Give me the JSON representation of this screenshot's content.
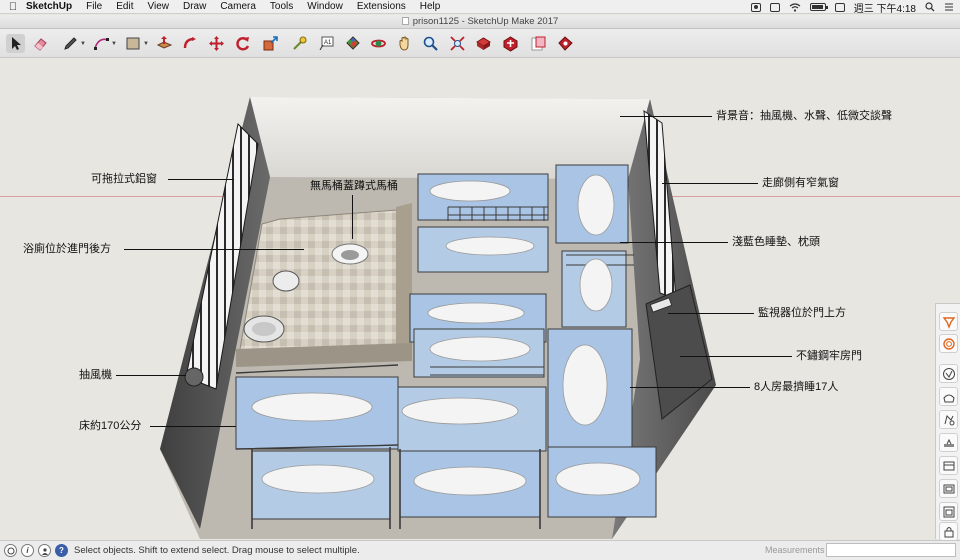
{
  "menubar": {
    "app_name": "SketchUp",
    "menus": [
      "File",
      "Edit",
      "View",
      "Draw",
      "Camera",
      "Tools",
      "Window",
      "Extensions",
      "Help"
    ],
    "clock": "週三 下午4:18"
  },
  "window": {
    "title": "prison1125 - SketchUp Make 2017"
  },
  "toolbar": {
    "tools": [
      "select-icon",
      "eraser-icon",
      "pencil-icon",
      "arc-icon",
      "rectangle-icon",
      "push-pull-icon",
      "follow-me-icon",
      "move-icon",
      "rotate-icon",
      "scale-icon",
      "tape-measure-icon",
      "text-icon",
      "paint-bucket-icon",
      "orbit-icon",
      "pan-icon",
      "zoom-icon",
      "zoom-extents-icon",
      "3d-warehouse-icon",
      "extension-warehouse-icon",
      "layout-icon",
      "extension-manager-icon"
    ]
  },
  "annotations": {
    "background_sound": "背景音：抽風機、水聲、低微交談聲",
    "corridor_window": "走廊側有窄氣窗",
    "sliding_window": "可拖拉式鋁窗",
    "squat_toilet": "無馬桶蓋蹲式馬桶",
    "bathroom": "浴廁位於進門後方",
    "mattress": "淺藍色睡墊、枕頭",
    "camera": "監視器位於門上方",
    "steel_door": "不鏽鋼牢房門",
    "exhaust_fan": "抽風機",
    "capacity": "8人房最擠睡17人",
    "bed_size": "床約170公分"
  },
  "colors": {
    "accent": "#e0661f",
    "mattress": "#a9c4e4",
    "wall": "#5f5f5f",
    "floor": "#b9b4ac"
  },
  "statusbar": {
    "message": "Select objects. Shift to extend select. Drag mouse to select multiple.",
    "measurements_label": "Measurements",
    "measurements_value": ""
  }
}
